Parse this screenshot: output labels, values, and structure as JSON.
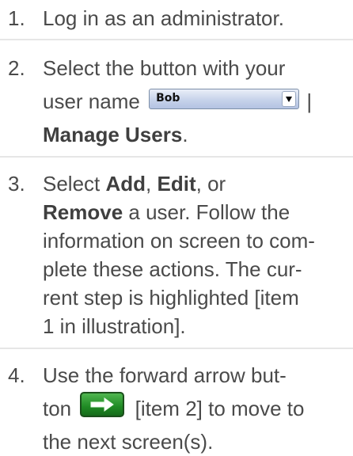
{
  "steps": [
    {
      "number": "1.",
      "text": "Log in as an administrator."
    },
    {
      "number": "2.",
      "line1": "Select the button with your",
      "line2_prefix": "user name",
      "user_select_value": "Bob",
      "separator": "|",
      "bold_target": "Manage Users",
      "end": "."
    },
    {
      "number": "3.",
      "select_word": "Select",
      "add": "Add",
      "comma1": ",",
      "edit": "Edit",
      "comma_or": ", or",
      "remove": "Remove",
      "rest": "a user. Follow the information on screen to com-plete these actions. The cur-rent step is highlighted [item 1 in illustration]."
    },
    {
      "number": "4.",
      "line1": "Use the forward arrow but-",
      "line2_prefix": "ton",
      "line2_suffix": "[item 2] to move to",
      "line3": "the next screen(s)."
    }
  ],
  "icons": {
    "user_select_arrow": "triangle-down-icon",
    "forward_button": "arrow-right-icon"
  },
  "colors": {
    "text": "#4a4a4a",
    "divider": "#e6e6e6",
    "select_gradient": "#c7d3ea",
    "button_green": "#1f8a24"
  }
}
